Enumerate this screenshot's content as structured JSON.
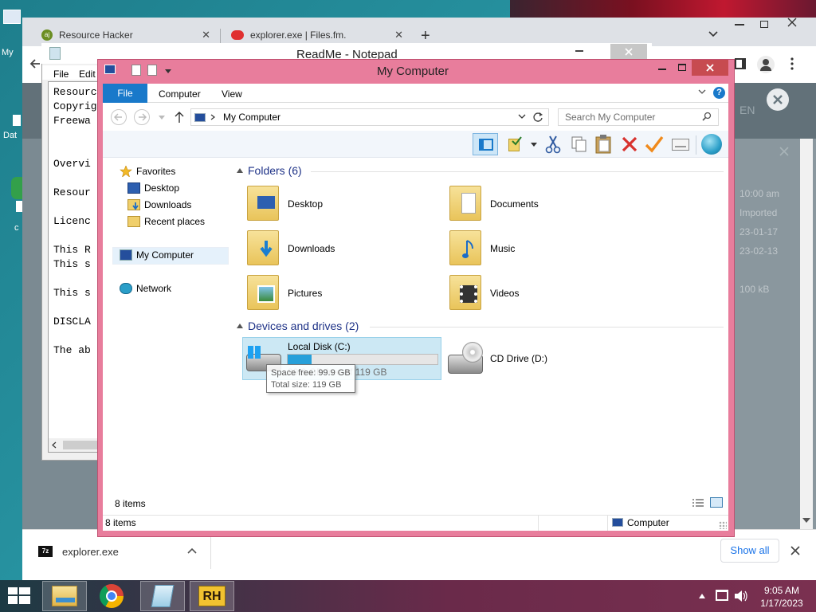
{
  "desktop": {
    "labels": [
      "My",
      "Dat"
    ],
    "tray_small_label": "c"
  },
  "chrome": {
    "tabs": [
      {
        "title": "Resource Hacker",
        "icon": "resource-hacker-icon"
      },
      {
        "title": "explorer.exe | Files.fm.",
        "icon": "filesfm-icon"
      }
    ],
    "new_tab": "+",
    "close_x": "✕",
    "background_text": {
      "lang": "EN",
      "lines": [
        "10:00 am",
        "Imported",
        "23-01-17",
        "23-02-13",
        "100 kB"
      ]
    },
    "download": {
      "filename": "explorer.exe",
      "show_all": "Show all"
    }
  },
  "notepad": {
    "title": "ReadMe - Notepad",
    "menu": [
      "File",
      "Edit"
    ],
    "lines": [
      "Resourc",
      "Copyrig",
      "Freewa",
      "Overvi",
      "Resour",
      "Licenc",
      "This R",
      "This s",
      "This s",
      "DISCLA",
      "The ab"
    ]
  },
  "explorer": {
    "title": "My Computer",
    "ribbon_tabs": {
      "file": "File",
      "computer": "Computer",
      "view": "View"
    },
    "address": "My Computer",
    "search_placeholder": "Search My Computer",
    "nav": {
      "favorites": "Favorites",
      "desktop": "Desktop",
      "downloads": "Downloads",
      "recent": "Recent places",
      "my_computer": "My Computer",
      "network": "Network"
    },
    "folders_header": "Folders (6)",
    "folders": [
      {
        "name": "Desktop",
        "icon": "desktop-folder-icon"
      },
      {
        "name": "Documents",
        "icon": "documents-folder-icon"
      },
      {
        "name": "Downloads",
        "icon": "downloads-folder-icon"
      },
      {
        "name": "Music",
        "icon": "music-folder-icon"
      },
      {
        "name": "Pictures",
        "icon": "pictures-folder-icon"
      },
      {
        "name": "Videos",
        "icon": "videos-folder-icon"
      }
    ],
    "devices_header": "Devices and drives (2)",
    "drive_c": {
      "name": "Local Disk (C:)",
      "free_text": "99.9 GB free of 119 GB",
      "usage_fraction": 0.16
    },
    "drive_d": {
      "name": "CD Drive (D:)"
    },
    "tooltip": {
      "line1": "Space free: 99.9 GB",
      "line2": "Total size: 119 GB"
    },
    "item_count": "8 items",
    "status_count": "8 items",
    "status_location": "Computer",
    "accent": "#1979ca",
    "frame_color": "#e87d9c"
  },
  "taskbar": {
    "time": "9:05 AM",
    "date": "1/17/2023",
    "apps": [
      "file-explorer-icon",
      "chrome-icon",
      "notepad-icon",
      "resource-hacker-icon"
    ]
  }
}
